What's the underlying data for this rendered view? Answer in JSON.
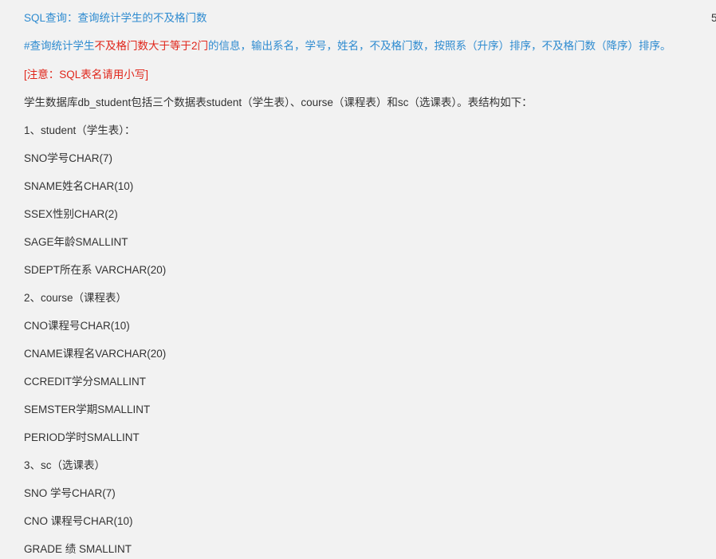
{
  "problem": {
    "title": "SQL查询：查询统计学生的不及格门数",
    "score": "5",
    "requirement": {
      "part1": "#查询统计学生",
      "part2": "不及格门数大于等于2门",
      "part3": "的信息，输出系名，学号，姓名，不及格门数，按照系（升序）排序，不及格门数（降序）排序。"
    },
    "note": "[注意：SQL表名请用小写]",
    "intro": "学生数据库db_student包括三个数据表student（学生表）、course（课程表）和sc（选课表）。表结构如下：",
    "lines": [
      "1、student（学生表）：",
      "SNO学号CHAR(7)",
      "SNAME姓名CHAR(10)",
      "SSEX性别CHAR(2)",
      "SAGE年龄SMALLINT",
      "SDEPT所在系 VARCHAR(20)",
      "2、course（课程表）",
      "CNO课程号CHAR(10)",
      "CNAME课程名VARCHAR(20)",
      "CCREDIT学分SMALLINT",
      "SEMSTER学期SMALLINT",
      "PERIOD学时SMALLINT",
      "3、sc（选课表）",
      "SNO 学号CHAR(7)",
      "CNO  课程号CHAR(10)",
      "GRADE  绩 SMALLINT"
    ]
  },
  "colors": {
    "background": "#f2f2f2",
    "title": "#2e8bd0",
    "red": "#e0261b",
    "text": "#333333"
  }
}
